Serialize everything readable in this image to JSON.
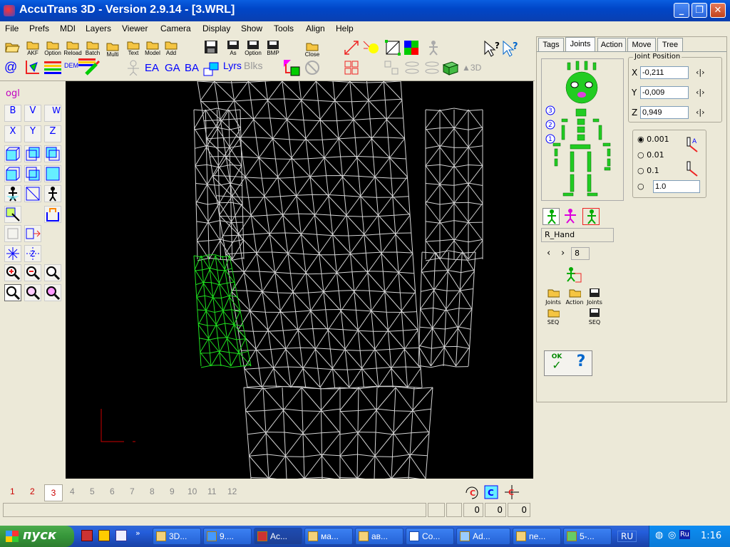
{
  "window": {
    "title": "AccuTrans 3D - Version 2.9.14 - [3.WRL]",
    "min": "_",
    "max": "❐",
    "close": "✕"
  },
  "menu": [
    "File",
    "Prefs",
    "MDI",
    "Layers",
    "Viewer",
    "Camera",
    "Display",
    "Show",
    "Tools",
    "Align",
    "Help"
  ],
  "toolbar": {
    "row1": [
      {
        "id": "akf",
        "label": "AKF"
      },
      {
        "id": "option",
        "label": "Option"
      },
      {
        "id": "reload",
        "label": "Reload"
      },
      {
        "id": "batch",
        "label": "Batch"
      },
      {
        "id": "multi",
        "label": "Multi"
      },
      {
        "id": "text",
        "label": "Text"
      },
      {
        "id": "model",
        "label": "Model"
      },
      {
        "id": "add",
        "label": "Add"
      },
      {
        "id": "save",
        "label": ""
      },
      {
        "id": "as",
        "label": "As"
      },
      {
        "id": "option2",
        "label": "Option"
      },
      {
        "id": "bmp",
        "label": "BMP"
      },
      {
        "id": "close",
        "label": "Close"
      }
    ],
    "row2": {
      "dem": "DEM",
      "ea": "EA",
      "ga": "GA",
      "ba": "BA",
      "lyrs": "Lyrs",
      "blks": "Blks",
      "three_d": "3D"
    }
  },
  "left": {
    "ogl": "ogl",
    "b": "B",
    "v": "V",
    "w": "W",
    "x": "X",
    "y": "Y",
    "z": "Z"
  },
  "right_panel": {
    "tabs": [
      "Tags",
      "Joints",
      "Action",
      "Move",
      "Tree"
    ],
    "active_tab": "Joints",
    "joint_position": {
      "title": "Joint Position",
      "x_label": "X",
      "x": "-0,211",
      "y_label": "Y",
      "y": "-0,009",
      "z_label": "Z",
      "z": "0,949"
    },
    "step": {
      "options": [
        "0.001",
        "0.01",
        "0.1"
      ],
      "custom": "1.0",
      "selected": "0.001"
    },
    "levels": [
      "3",
      "2",
      "1"
    ],
    "joint_name": "R_Hand",
    "joint_index": "8",
    "buttons": {
      "load_joints": "Joints",
      "load_action": "Action",
      "save_joints": "Joints",
      "load_seq": "SEQ",
      "save_seq": "SEQ",
      "ok": "OK"
    }
  },
  "frames": {
    "items": [
      "1",
      "2",
      "3",
      "4",
      "5",
      "6",
      "7",
      "8",
      "9",
      "10",
      "11",
      "12"
    ],
    "active": "3"
  },
  "status": {
    "v1": "0",
    "v2": "0",
    "v3": "0"
  },
  "taskbar": {
    "start": "пуск",
    "tasks": [
      "3D...",
      "9....",
      "Ac...",
      "ма...",
      "ав...",
      "Co...",
      "Ad...",
      "ne...",
      "5-..."
    ],
    "lang": "RU",
    "tray_lang": "Ru",
    "clock": "1:16"
  },
  "colors": {
    "selected_mesh": "#1fe01f",
    "mesh": "#d8d8d8",
    "viewport": "#000000"
  }
}
